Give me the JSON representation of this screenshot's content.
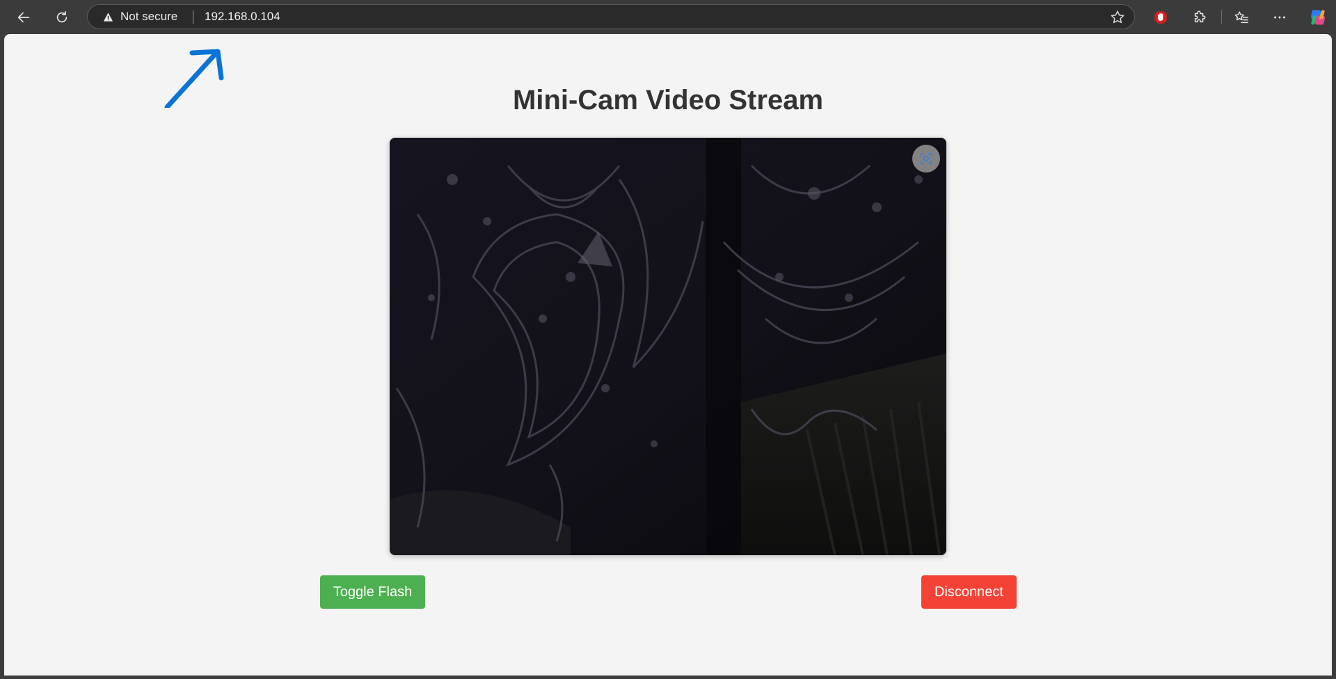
{
  "browser": {
    "security_label": "Not secure",
    "url": "192.168.0.104",
    "icons": [
      "back-icon",
      "refresh-icon",
      "warning-icon",
      "star-icon",
      "adblock-icon",
      "extensions-icon",
      "favorites-icon",
      "more-icon",
      "copilot-icon"
    ]
  },
  "page": {
    "title": "Mini-Cam Video Stream",
    "buttons": {
      "toggle_flash": "Toggle Flash",
      "disconnect": "Disconnect"
    },
    "colors": {
      "flash_button": "#4caf50",
      "disconnect_button": "#f44336",
      "annotation_arrow": "#0a74d6"
    }
  }
}
